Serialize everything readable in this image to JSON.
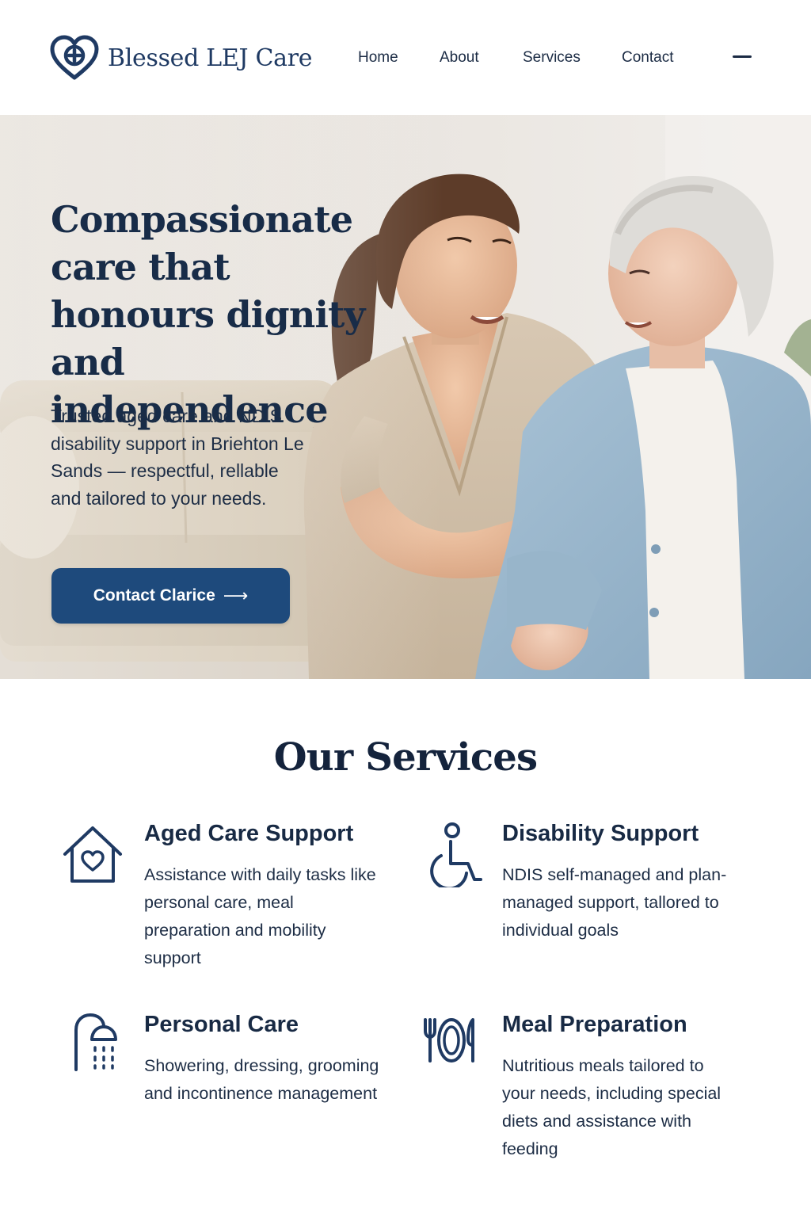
{
  "brand": {
    "name": "Blessed LEJ Care",
    "logo_icon": "heart-plus-icon",
    "primary_color": "#1f3a63",
    "accent_color": "#1e4a7c"
  },
  "nav": {
    "items": [
      {
        "label": "Home"
      },
      {
        "label": "About"
      },
      {
        "label": "Services"
      },
      {
        "label": "Contact"
      }
    ],
    "menu_icon": "menu-icon"
  },
  "hero": {
    "title": "Compassionate care that honours dignity and independence",
    "subtitle": "Trusted aged care and NDIS disability support in Briehton Le Sands — respectful, rellable and tailored to your needs.",
    "cta_label": "Contact Clarice",
    "cta_icon": "arrow-right-icon"
  },
  "services": {
    "title": "Our Services",
    "items": [
      {
        "title": "Aged Care Support",
        "description": "Assistance with daily tasks like personal care, meal preparation and mobility support",
        "icon": "house-heart-icon"
      },
      {
        "title": "Disability Support",
        "description": "NDIS self-managed and plan-managed support, tallored to individual goals",
        "icon": "wheelchair-icon"
      },
      {
        "title": "Personal Care",
        "description": "Showering, dressing, grooming and incontinence management",
        "icon": "shower-icon"
      },
      {
        "title": "Meal Preparation",
        "description": "Nutritious meals tailored to your needs, including special diets and assistance with feeding",
        "icon": "plate-cutlery-icon"
      }
    ]
  }
}
